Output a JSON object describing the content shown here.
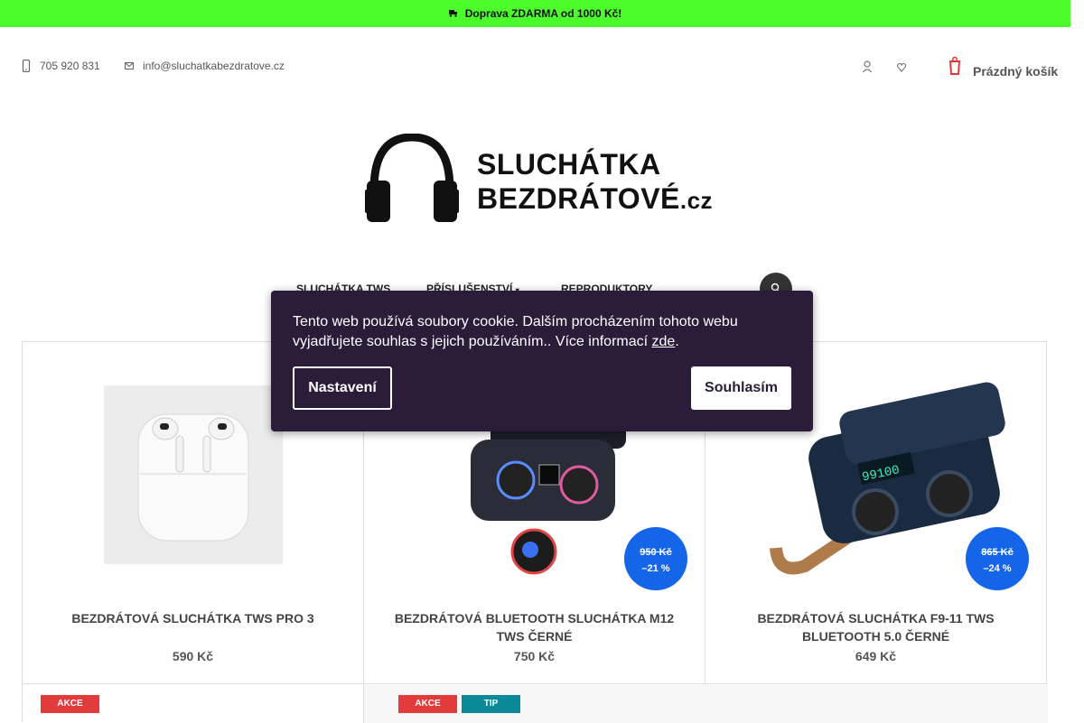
{
  "topbar": {
    "text": "Doprava ZDARMA od 1000 Kč!",
    "icon": "truck-icon",
    "bg_color": "#4cfc2c"
  },
  "contact": {
    "phone": "705 920 831",
    "email": "info@sluchatkabezdratove.cz"
  },
  "header": {
    "cart_label": "Prázdný košík",
    "icons": [
      "user-icon",
      "heart-icon",
      "cart-icon"
    ]
  },
  "logo": {
    "line1": "SLUCHÁTKA",
    "line2": "BEZDRÁTOVÉ",
    "suffix": ".cz"
  },
  "nav": {
    "items": [
      "SLUCHÁTKA TWS",
      "PŘÍSLUŠENSTVÍ",
      "REPRODUKTORY"
    ],
    "search_icon": "search-icon"
  },
  "products": [
    {
      "name": "BEZDRÁTOVÁ SLUCHÁTKA TWS PRO 3",
      "price": "590 Kč",
      "old_price": "",
      "discount": ""
    },
    {
      "name": "BEZDRÁTOVÁ BLUETOOTH SLUCHÁTKA M12 TWS ČERNÉ",
      "price": "750 Kč",
      "old_price": "950 Kč",
      "discount": "–21 %"
    },
    {
      "name": "BEZDRÁTOVÁ SLUCHÁTKA F9-11 TWS BLUETOOTH 5.0 ČERNÉ",
      "price": "649 Kč",
      "old_price": "865 Kč",
      "discount": "–24 %"
    }
  ],
  "flags": {
    "akce": "AKCE",
    "tip": "TIP",
    "akce_color": "#e23b3b",
    "tip_color": "#0a8a99"
  },
  "cookie": {
    "text": "Tento web používá soubory cookie. Dalším procházením tohoto webu vyjadřujete souhlas s jejich používáním.. Více informací ",
    "link": "zde",
    "link_suffix": ".",
    "settings_label": "Nastavení",
    "agree_label": "Souhlasím",
    "bg_color": "#2b1c3a"
  },
  "discount_color": "#1565e8"
}
